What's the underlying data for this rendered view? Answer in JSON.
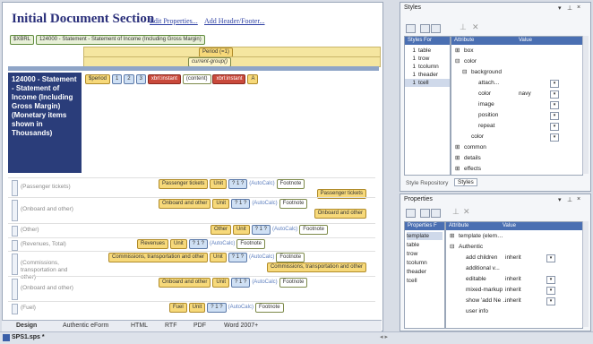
{
  "design": {
    "title": "Initial Document Section",
    "edit_properties": "Edit Properties...",
    "add_header": "Add Header/Footer...",
    "breadcrumb": [
      "$XBRL",
      "124000 - Statement - Statement of Income (Including Gross Margin)"
    ],
    "period_tag": "Period (=1)",
    "current_group": "current-group()",
    "header_cell": "124000 - Statement - Statement of Income (Including Gross Margin) (Monetary items shown in Thousands)",
    "header_row_tags": [
      "$period",
      "1",
      "2",
      "3",
      "xbrl:instant",
      "(content)",
      "xbrl:instant",
      "A"
    ],
    "rows": [
      {
        "label": "(Passenger tickets)",
        "concept": "Passenger tickets"
      },
      {
        "label": "(Onboard and other)",
        "concept": "Onboard and other"
      },
      {
        "label": "(Other)",
        "concept": "Other"
      },
      {
        "label": "(Revenues, Total)",
        "concept": "Revenues"
      },
      {
        "label": "(Commissions, transportation and other)",
        "concept": "Commissions, transportation and other"
      },
      {
        "label": "(Onboard and other)",
        "concept": "Onboard and other"
      },
      {
        "label": "(Fuel)",
        "concept": "Fuel"
      }
    ],
    "unit": "Unit",
    "autocalc": "(AutoCalc)",
    "footnote": "Footnote"
  },
  "view_tabs": [
    "Design",
    "Authentic eForm",
    "HTML",
    "RTF",
    "PDF",
    "Word 2007+"
  ],
  "status": {
    "file": "SPS1.sps *"
  },
  "styles_panel": {
    "title": "Styles",
    "col_styles_for": "Styles For",
    "col_attribute": "Attribute",
    "col_value": "Value",
    "styles_for": [
      {
        "count": "1",
        "name": "table"
      },
      {
        "count": "1",
        "name": "trow"
      },
      {
        "count": "1",
        "name": "tcolumn"
      },
      {
        "count": "1",
        "name": "theader"
      },
      {
        "count": "1",
        "name": "tcell"
      }
    ],
    "attributes": [
      {
        "indent": 0,
        "toggle": "⊞",
        "name": "box",
        "value": ""
      },
      {
        "indent": 0,
        "toggle": "⊟",
        "name": "color",
        "value": ""
      },
      {
        "indent": 1,
        "toggle": "⊟",
        "name": "background",
        "value": ""
      },
      {
        "indent": 2,
        "toggle": "",
        "name": "attach...",
        "value": ""
      },
      {
        "indent": 2,
        "toggle": "",
        "name": "color",
        "value": "navy"
      },
      {
        "indent": 2,
        "toggle": "",
        "name": "image",
        "value": ""
      },
      {
        "indent": 2,
        "toggle": "",
        "name": "position",
        "value": ""
      },
      {
        "indent": 2,
        "toggle": "",
        "name": "repeat",
        "value": ""
      },
      {
        "indent": 1,
        "toggle": "",
        "name": "color",
        "value": ""
      },
      {
        "indent": 0,
        "toggle": "⊞",
        "name": "common",
        "value": ""
      },
      {
        "indent": 0,
        "toggle": "⊞",
        "name": "details",
        "value": ""
      },
      {
        "indent": 0,
        "toggle": "⊞",
        "name": "effects",
        "value": ""
      }
    ],
    "tabs": [
      "Style Repository",
      "Styles"
    ]
  },
  "properties_panel": {
    "title": "Properties",
    "col_properties_for": "Properties F",
    "col_attribute": "Attribute",
    "col_value": "Value",
    "properties_for": [
      "template",
      "table",
      "trow",
      "tcolumn",
      "theader",
      "tcell"
    ],
    "attributes": [
      {
        "indent": 0,
        "toggle": "⊞",
        "name": "template (element)",
        "value": ""
      },
      {
        "indent": 0,
        "toggle": "⊟",
        "name": "Authentic",
        "value": ""
      },
      {
        "indent": 1,
        "toggle": "",
        "name": "add children",
        "value": "inherit"
      },
      {
        "indent": 1,
        "toggle": "",
        "name": "additional v...",
        "value": ""
      },
      {
        "indent": 1,
        "toggle": "",
        "name": "editable",
        "value": "inherit"
      },
      {
        "indent": 1,
        "toggle": "",
        "name": "mixed-markup",
        "value": "inherit"
      },
      {
        "indent": 1,
        "toggle": "",
        "name": "show 'add Ne XML Elemen...",
        "value": "inherit"
      },
      {
        "indent": 1,
        "toggle": "",
        "name": "user info",
        "value": ""
      }
    ]
  },
  "colors": {
    "header": "#2a3d7a",
    "grid_header": "#4a6fb2",
    "link": "#2c3fa3"
  }
}
